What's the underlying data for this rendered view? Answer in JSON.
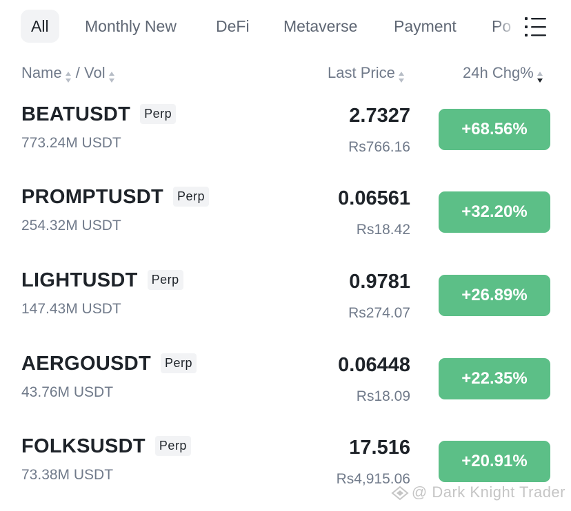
{
  "tabs": [
    {
      "label": "All",
      "active": true
    },
    {
      "label": "Monthly New",
      "active": false
    },
    {
      "label": "DeFi",
      "active": false
    },
    {
      "label": "Metaverse",
      "active": false
    },
    {
      "label": "Payment",
      "active": false
    },
    {
      "label": "Po",
      "active": false
    }
  ],
  "menu_icon": "list-menu-icon",
  "header": {
    "name_label": "Name",
    "separator": " / ",
    "vol_label": "Vol",
    "price_label": "Last Price",
    "change_label": "24h Chg%"
  },
  "rows": [
    {
      "symbol": "BEATUSDT",
      "badge": "Perp",
      "volume": "773.24M USDT",
      "price": "2.7327",
      "fiat": "Rs766.16",
      "change": "+68.56%"
    },
    {
      "symbol": "PROMPTUSDT",
      "badge": "Perp",
      "volume": "254.32M USDT",
      "price": "0.06561",
      "fiat": "Rs18.42",
      "change": "+32.20%"
    },
    {
      "symbol": "LIGHTUSDT",
      "badge": "Perp",
      "volume": "147.43M USDT",
      "price": "0.9781",
      "fiat": "Rs274.07",
      "change": "+26.89%"
    },
    {
      "symbol": "AERGOUSDT",
      "badge": "Perp",
      "volume": "43.76M USDT",
      "price": "0.06448",
      "fiat": "Rs18.09",
      "change": "+22.35%"
    },
    {
      "symbol": "FOLKSUSDT",
      "badge": "Perp",
      "volume": "73.38M USDT",
      "price": "17.516",
      "fiat": "Rs4,915.06",
      "change": "+20.91%"
    }
  ],
  "colors": {
    "positive": "#5cbf87",
    "text_primary": "#1e2329",
    "text_secondary": "#707a8a",
    "tab_active_bg": "#f2f3f5"
  },
  "watermark": "@ Dark Knight Trader"
}
